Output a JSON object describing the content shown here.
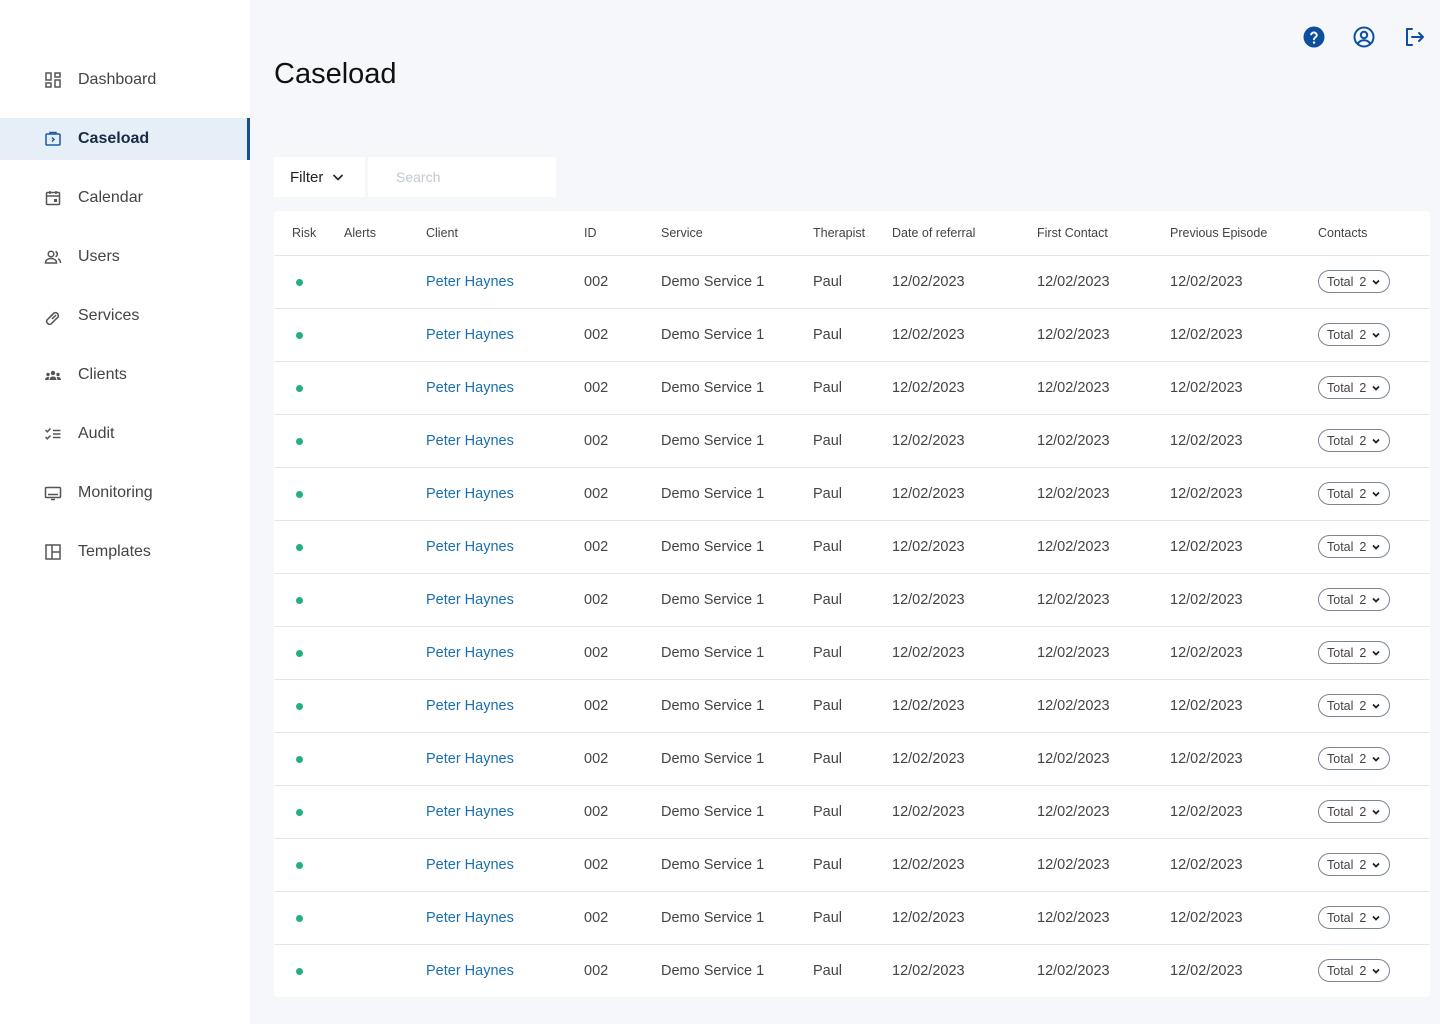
{
  "sidebar": {
    "items": [
      {
        "label": "Dashboard",
        "icon": "dashboard-icon",
        "active": false
      },
      {
        "label": "Caseload",
        "icon": "caseload-icon",
        "active": true
      },
      {
        "label": "Calendar",
        "icon": "calendar-icon",
        "active": false
      },
      {
        "label": "Users",
        "icon": "users-icon",
        "active": false
      },
      {
        "label": "Services",
        "icon": "services-icon",
        "active": false
      },
      {
        "label": "Clients",
        "icon": "clients-icon",
        "active": false
      },
      {
        "label": "Audit",
        "icon": "audit-icon",
        "active": false
      },
      {
        "label": "Monitoring",
        "icon": "monitoring-icon",
        "active": false
      },
      {
        "label": "Templates",
        "icon": "templates-icon",
        "active": false
      }
    ]
  },
  "header": {
    "icons": [
      "help-icon",
      "account-icon",
      "logout-icon"
    ],
    "accent_color": "#0b4f9e"
  },
  "page": {
    "title": "Caseload"
  },
  "toolbar": {
    "filter_label": "Filter",
    "search_placeholder": "Search"
  },
  "table": {
    "columns": [
      "Risk",
      "Alerts",
      "Client",
      "ID",
      "Service",
      "Therapist",
      "Date of referral",
      "First Contact",
      "Previous Episode",
      "Contacts"
    ],
    "risk_color": "#22b07d",
    "rows": [
      {
        "client": "Peter Haynes",
        "id": "002",
        "service": "Demo Service 1",
        "therapist": "Paul",
        "referral": "12/02/2023",
        "first_contact": "12/02/2023",
        "previous_episode": "12/02/2023",
        "contacts_label": "Total",
        "contacts_total": "2"
      },
      {
        "client": "Peter Haynes",
        "id": "002",
        "service": "Demo Service 1",
        "therapist": "Paul",
        "referral": "12/02/2023",
        "first_contact": "12/02/2023",
        "previous_episode": "12/02/2023",
        "contacts_label": "Total",
        "contacts_total": "2"
      },
      {
        "client": "Peter Haynes",
        "id": "002",
        "service": "Demo Service 1",
        "therapist": "Paul",
        "referral": "12/02/2023",
        "first_contact": "12/02/2023",
        "previous_episode": "12/02/2023",
        "contacts_label": "Total",
        "contacts_total": "2"
      },
      {
        "client": "Peter Haynes",
        "id": "002",
        "service": "Demo Service 1",
        "therapist": "Paul",
        "referral": "12/02/2023",
        "first_contact": "12/02/2023",
        "previous_episode": "12/02/2023",
        "contacts_label": "Total",
        "contacts_total": "2"
      },
      {
        "client": "Peter Haynes",
        "id": "002",
        "service": "Demo Service 1",
        "therapist": "Paul",
        "referral": "12/02/2023",
        "first_contact": "12/02/2023",
        "previous_episode": "12/02/2023",
        "contacts_label": "Total",
        "contacts_total": "2"
      },
      {
        "client": "Peter Haynes",
        "id": "002",
        "service": "Demo Service 1",
        "therapist": "Paul",
        "referral": "12/02/2023",
        "first_contact": "12/02/2023",
        "previous_episode": "12/02/2023",
        "contacts_label": "Total",
        "contacts_total": "2"
      },
      {
        "client": "Peter Haynes",
        "id": "002",
        "service": "Demo Service 1",
        "therapist": "Paul",
        "referral": "12/02/2023",
        "first_contact": "12/02/2023",
        "previous_episode": "12/02/2023",
        "contacts_label": "Total",
        "contacts_total": "2"
      },
      {
        "client": "Peter Haynes",
        "id": "002",
        "service": "Demo Service 1",
        "therapist": "Paul",
        "referral": "12/02/2023",
        "first_contact": "12/02/2023",
        "previous_episode": "12/02/2023",
        "contacts_label": "Total",
        "contacts_total": "2"
      },
      {
        "client": "Peter Haynes",
        "id": "002",
        "service": "Demo Service 1",
        "therapist": "Paul",
        "referral": "12/02/2023",
        "first_contact": "12/02/2023",
        "previous_episode": "12/02/2023",
        "contacts_label": "Total",
        "contacts_total": "2"
      },
      {
        "client": "Peter Haynes",
        "id": "002",
        "service": "Demo Service 1",
        "therapist": "Paul",
        "referral": "12/02/2023",
        "first_contact": "12/02/2023",
        "previous_episode": "12/02/2023",
        "contacts_label": "Total",
        "contacts_total": "2"
      },
      {
        "client": "Peter Haynes",
        "id": "002",
        "service": "Demo Service 1",
        "therapist": "Paul",
        "referral": "12/02/2023",
        "first_contact": "12/02/2023",
        "previous_episode": "12/02/2023",
        "contacts_label": "Total",
        "contacts_total": "2"
      },
      {
        "client": "Peter Haynes",
        "id": "002",
        "service": "Demo Service 1",
        "therapist": "Paul",
        "referral": "12/02/2023",
        "first_contact": "12/02/2023",
        "previous_episode": "12/02/2023",
        "contacts_label": "Total",
        "contacts_total": "2"
      },
      {
        "client": "Peter Haynes",
        "id": "002",
        "service": "Demo Service 1",
        "therapist": "Paul",
        "referral": "12/02/2023",
        "first_contact": "12/02/2023",
        "previous_episode": "12/02/2023",
        "contacts_label": "Total",
        "contacts_total": "2"
      },
      {
        "client": "Peter Haynes",
        "id": "002",
        "service": "Demo Service 1",
        "therapist": "Paul",
        "referral": "12/02/2023",
        "first_contact": "12/02/2023",
        "previous_episode": "12/02/2023",
        "contacts_label": "Total",
        "contacts_total": "2"
      }
    ]
  }
}
